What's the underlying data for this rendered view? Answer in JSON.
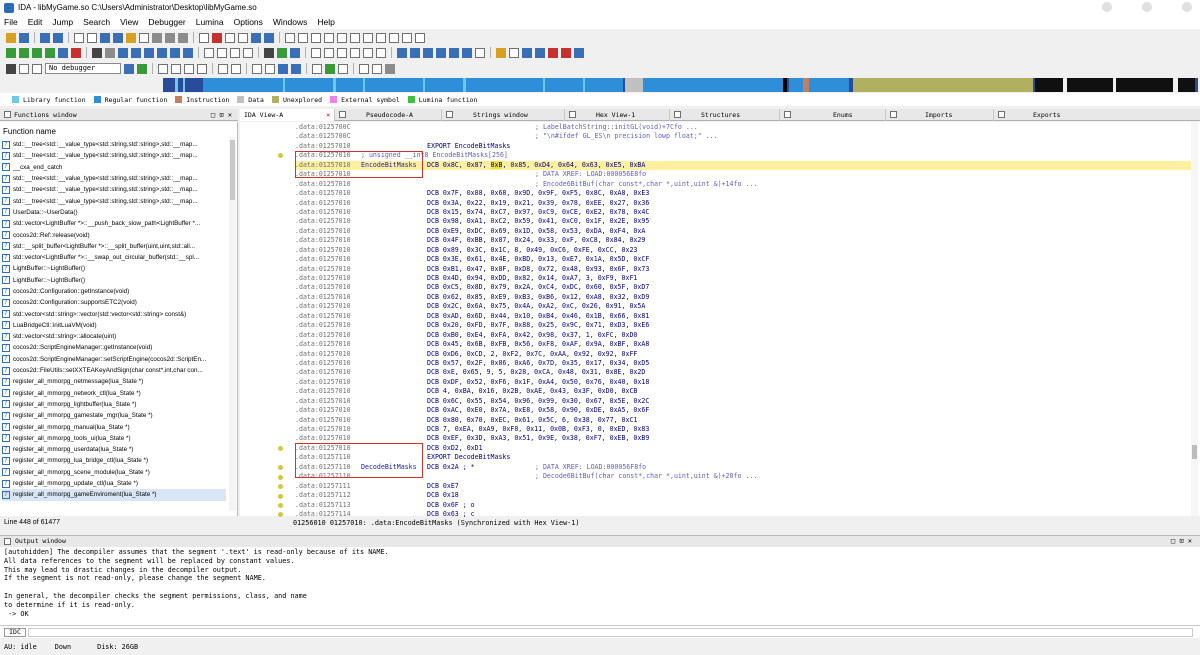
{
  "window": {
    "title": "IDA - libMyGame.so C:\\Users\\Administrator\\Desktop\\libMyGame.so"
  },
  "menu": [
    "File",
    "Edit",
    "Jump",
    "Search",
    "View",
    "Debugger",
    "Lumina",
    "Options",
    "Windows",
    "Help"
  ],
  "debugger_select": "No debugger",
  "legend": [
    {
      "label": "Library function",
      "color": "#6ec8e8"
    },
    {
      "label": "Regular function",
      "color": "#2f8ed8"
    },
    {
      "label": "Instruction",
      "color": "#c08060"
    },
    {
      "label": "Data",
      "color": "#c0c0c0"
    },
    {
      "label": "Unexplored",
      "color": "#b0b060"
    },
    {
      "label": "External symbol",
      "color": "#f080f0"
    },
    {
      "label": "Lumina function",
      "color": "#40c040"
    }
  ],
  "tabs": {
    "functions": "Functions window",
    "idaview": "IDA View-A",
    "pseudocode": "Pseudocode-A",
    "strings": "Strings window",
    "hexview": "Hex View-1",
    "structures": "Structures",
    "enums": "Enums",
    "imports": "Imports",
    "exports": "Exports"
  },
  "functions_panel": {
    "header": "Function name",
    "items": [
      "std::__tree<std::__value_type<std::string,std::string>,std::__map...",
      "std::__tree<std::__value_type<std::string,std::string>,std::__map...",
      "__cxa_end_catch",
      "std::__tree<std::__value_type<std::string,std::string>,std::__map...",
      "std::__tree<std::__value_type<std::string,std::string>,std::__map...",
      "std::__tree<std::__value_type<std::string,std::string>,std::__map...",
      "UserData::~UserData()",
      "std::vector<LightBuffer *>::__push_back_slow_path<LightBuffer *...",
      "cocos2d::Ref::release(void)",
      "std::__split_buffer<LightBuffer *>::__split_buffer(uint,uint,std::all...",
      "std::vector<LightBuffer *>::__swap_out_circular_buffer(std::__spl...",
      "LightBuffer::~LightBuffer()",
      "LightBuffer::~LightBuffer()",
      "cocos2d::Configuration::getInstance(void)",
      "cocos2d::Configuration::supportsETC2(void)",
      "std::vector<std::string>::vector(std::vector<std::string> const&)",
      "LuaBridgeCtl::initLuaVM(void)",
      "std::vector<std::string>::allocate(uint)",
      "cocos2d::ScriptEngineManager::getInstance(void)",
      "cocos2d::ScriptEngineManager::setScriptEngine(cocos2d::ScriptEn...",
      "cocos2d::FileUtils::setXXTEAKeyAndSign(char const*,int,char con...",
      "register_all_mmorpg_netmessage(lua_State *)",
      "register_all_mmorpg_network_ctl(lua_State *)",
      "register_all_mmorpg_lightbuffer(lua_State *)",
      "register_all_mmorpg_gamestate_mgr(lua_State *)",
      "register_all_mmorpg_manual(lua_State *)",
      "register_all_mmorpg_tools_ui(lua_State *)",
      "register_all_mmorpg_userdata(lua_State *)",
      "register_all_mmorpg_lua_bridge_ctl(lua_State *)",
      "register_all_mmorpg_scene_module(lua_State *)",
      "register_all_mmorpg_update_ctl(lua_State *)",
      "register_all_mmorpg_gameEnviroment(lua_State *)"
    ],
    "status": "Line 448 of 61477"
  },
  "code_lines": [
    {
      "addr": ".data:0125700C",
      "body": "",
      "cm": "; LabelBatchString::initGL(void)+7Cfo ..."
    },
    {
      "addr": ".data:0125700C",
      "body": "",
      "cm": "; \"\\n#ifdef GL_ES\\n precision lowp float;\" ..."
    },
    {
      "addr": ".data:01257010",
      "body": "EXPORT EncodeBitMasks",
      "cm": ""
    },
    {
      "addr": ".data:01257010",
      "body": "; unsigned __int8 EncodeBitMasks[256]",
      "cm": ""
    },
    {
      "addr": ".data:01257010",
      "lbl": "EncodeBitMasks",
      "body": "DCB 0x8C, 0x87, ",
      "hv": "0xB",
      "tail": ", 0x85, 0xD4, 0x64, 0x63, 0xE5, 0xBA",
      "cm": "",
      "hl": true
    },
    {
      "addr": ".data:01257010",
      "body": "",
      "cm": "; DATA XREF: LOAD:000056E8fo"
    },
    {
      "addr": ".data:01257010",
      "body": "",
      "cm": "; Encode6BitBuf(char const*,char *,uint,uint &)+14fo ..."
    },
    {
      "addr": ".data:01257010",
      "body": "DCB 0x7F, 0x88, 0x68, 0x9D, 0x9F, 0xF5, 0x8C, 0xA8, 0xE3",
      "cm": ""
    },
    {
      "addr": ".data:01257010",
      "body": "DCB 0x3A, 0x22, 0x19, 0x21, 0x39, 0x78, 0xEE, 0x27, 0x36",
      "cm": ""
    },
    {
      "addr": ".data:01257010",
      "body": "DCB 0x15, 0x74, 0xC7, 0x97, 0xC9, 0xCE, 0xE2, 0x78, 0x4C",
      "cm": ""
    },
    {
      "addr": ".data:01257010",
      "body": "DCB 0x98, 0xA1, 0xC2, 0x59, 0x41, 0xC0, 0x1F, 0x2E, 0x95",
      "cm": ""
    },
    {
      "addr": ".data:01257010",
      "body": "DCB 0xE9, 0xDC, 0x69, 0x1D, 0x58, 0x53, 0xDA, 0xF4, 0xA",
      "cm": ""
    },
    {
      "addr": ".data:01257010",
      "body": "DCB 0x4F, 0xBB, 0x87, 0x24, 0x33, 0xF, 0xC8, 0x84, 0x29",
      "cm": ""
    },
    {
      "addr": ".data:01257010",
      "body": "DCB 0x89, 0x3C, 0x1C, 8, 0x49, 0xC6, 0xFE, 0xCC, 0x23",
      "cm": ""
    },
    {
      "addr": ".data:01257010",
      "body": "DCB 0x3E, 0x61, 0x4E, 0xBD, 0x13, 0xE7, 0x1A, 0x5D, 0xCF",
      "cm": ""
    },
    {
      "addr": ".data:01257010",
      "body": "DCB 0xB1, 0x47, 0x8F, 0xD8, 0x72, 0x48, 0x93, 0x6F, 0x73",
      "cm": ""
    },
    {
      "addr": ".data:01257010",
      "body": "DCB 0x4D, 0x94, 0xDD, 0x82, 0x14, 0xA7, 3, 0xF9, 0xF1",
      "cm": ""
    },
    {
      "addr": ".data:01257010",
      "body": "DCB 0xC5, 0x8D, 0x79, 0x2A, 0xC4, 0xDC, 0x60, 0x5F, 0xD7",
      "cm": ""
    },
    {
      "addr": ".data:01257010",
      "body": "DCB 0x62, 0x85, 0xE9, 0xB3, 0xB6, 0x12, 0xA8, 0x32, 0xD9",
      "cm": ""
    },
    {
      "addr": ".data:01257010",
      "body": "DCB 0x2C, 0x6A, 0x75, 0x4A, 0xA2, 0xC, 0x26, 0x91, 0x5A",
      "cm": ""
    },
    {
      "addr": ".data:01257010",
      "body": "DCB 0xAD, 0x6D, 0x44, 0x10, 0xB4, 0x46, 0x1B, 0x66, 0x81",
      "cm": ""
    },
    {
      "addr": ".data:01257010",
      "body": "DCB 0x20, 0xFD, 0x7F, 0x88, 0x25, 0x9C, 0x71, 0xD3, 0xE6",
      "cm": ""
    },
    {
      "addr": ".data:01257010",
      "body": "DCB 0xB0, 0xE4, 0xFA, 0x42, 0x98, 0x37, 1, 0xFC, 0xD0",
      "cm": ""
    },
    {
      "addr": ".data:01257010",
      "body": "DCB 0x45, 0x6B, 0xFB, 0x56, 0xF8, 0xAF, 0x9A, 0xBF, 0xA8",
      "cm": ""
    },
    {
      "addr": ".data:01257010",
      "body": "DCB 0xD6, 0xCD, 2, 0xF2, 0x7C, 0xAA, 0x92, 0x92, 0xFF",
      "cm": ""
    },
    {
      "addr": ".data:01257010",
      "body": "DCB 0x57, 0x2F, 0x86, 0xA6, 0x7D, 0x35, 0x17, 0x34, 0xD5",
      "cm": ""
    },
    {
      "addr": ".data:01257010",
      "body": "DCB 0xE, 0x65, 9, 5, 0x28, 0xCA, 0x48, 0x31, 0x8E, 0x2D",
      "cm": ""
    },
    {
      "addr": ".data:01257010",
      "body": "DCB 0xDF, 0x52, 0xF6, 0x1F, 0xA4, 0x50, 0x76, 0x40, 0x18",
      "cm": ""
    },
    {
      "addr": ".data:01257010",
      "body": "DCB 4, 0xBA, 0x16, 0x2B, 0xAE, 0x43, 0x3F, 0xD0, 0xCB",
      "cm": ""
    },
    {
      "addr": ".data:01257010",
      "body": "DCB 0x6C, 0x55, 0x54, 0x96, 0x99, 0x30, 0x67, 0x5E, 0x2C",
      "cm": ""
    },
    {
      "addr": ".data:01257010",
      "body": "DCB 0xAC, 0xE0, 0x7A, 0xE8, 0x58, 0x90, 0xDE, 0xA5, 0x6F",
      "cm": ""
    },
    {
      "addr": ".data:01257010",
      "body": "DCB 0x80, 0x70, 0xEC, 0x61, 0x5C, 6, 0x38, 0x77, 0xC1",
      "cm": ""
    },
    {
      "addr": ".data:01257010",
      "body": "DCB 7, 0xEA, 0xA9, 0xF8, 0x11, 0x0B, 0xF3, 0, 0xED, 0x83",
      "cm": ""
    },
    {
      "addr": ".data:01257010",
      "body": "DCB 0xEF, 0x3D, 0xA3, 0x51, 0x9E, 0x38, 0xF7, 0xEB, 0xB9",
      "cm": ""
    },
    {
      "addr": ".data:01257010",
      "body": "DCB 0xD2, 0xD1",
      "cm": ""
    },
    {
      "addr": ".data:01257110",
      "body": "EXPORT DecodeBitMasks",
      "cm": ""
    },
    {
      "addr": ".data:01257110",
      "lbl": "DecodeBitMasks",
      "body": "DCB 0x2A ; *",
      "cm": "; DATA XREF: LOAD:000056F8fo"
    },
    {
      "addr": ".data:01257110",
      "body": "",
      "cm": "; Decode6BitBuf(char const*,char *,uint,uint &)+20fo ..."
    },
    {
      "addr": ".data:01257111",
      "body": "DCB 0xE7",
      "cm": ""
    },
    {
      "addr": ".data:01257112",
      "body": "DCB 0x18",
      "cm": ""
    },
    {
      "addr": ".data:01257113",
      "body": "DCB 0x6F ; o",
      "cm": ""
    },
    {
      "addr": ".data:01257114",
      "body": "DCB 0x63 ; c",
      "cm": ""
    }
  ],
  "ida_status": "01256010 01257010: .data:EncodeBitMasks (Synchronized with Hex View-1)",
  "output": {
    "title": "Output window",
    "text": "[autohidden] The decompiler assumes that the segment '.text' is read-only because of its NAME.\nAll data references to the segment will be replaced by constant values.\nThis may lead to drastic changes in the decompiler output.\nIf the segment is not read-only, please change the segment NAME.\n\nIn general, the decompiler checks the segment permissions, class, and name\nto determine if it is read-only.\n -> OK"
  },
  "cmd": {
    "label": "IDC"
  },
  "status": {
    "au": "AU:  idle",
    "dir": "Down",
    "disk": "Disk: 26GB"
  }
}
